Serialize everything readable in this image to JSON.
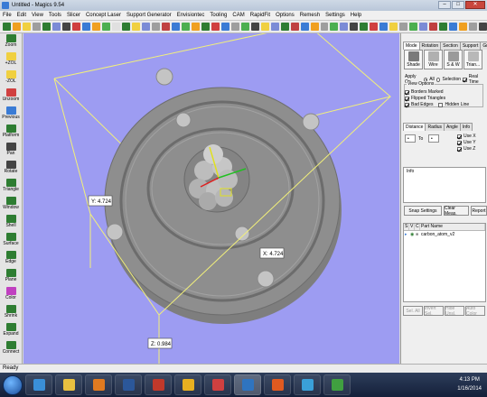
{
  "window": {
    "title": "Untitled - Magics 9.54"
  },
  "menu": [
    "File",
    "Edit",
    "View",
    "Tools",
    "Slicer",
    "Concept Laser",
    "Support Generator",
    "Envisiontec",
    "Tooling",
    "CAM",
    "RapidFit",
    "Options",
    "Remesh",
    "Settings",
    "Help"
  ],
  "toolbar_colors": [
    "#2e7d32",
    "#f0a020",
    "#f0d040",
    "#9e9e9e",
    "#2e7d32",
    "#7b8bd6",
    "#444",
    "#d04040",
    "#3a7bd5",
    "#f0a020",
    "#4caf50",
    "#e0e0e0",
    "#2e7d32",
    "#f0d040",
    "#7b8bd6",
    "#9e9e9e",
    "#c04040",
    "#3a7bd5",
    "#4caf50",
    "#f0a020",
    "#2e7d32",
    "#d04040",
    "#3a7bd5",
    "#9e9e9e",
    "#4caf50",
    "#444",
    "#f0d040",
    "#7b8bd6",
    "#2e7d32",
    "#c04040",
    "#3a7bd5",
    "#f0a020",
    "#9e9e9e",
    "#4caf50",
    "#7b8bd6",
    "#444",
    "#2e7d32",
    "#d04040",
    "#3a7bd5",
    "#f0d040",
    "#9e9e9e",
    "#4caf50",
    "#7b8bd6",
    "#c04040",
    "#2e7d32",
    "#3a7bd5",
    "#f0a020",
    "#9e9e9e",
    "#444"
  ],
  "left_tools": [
    {
      "label": "Zoom",
      "color": "#2e7d32"
    },
    {
      "label": "+ZOL",
      "color": "#f0d040"
    },
    {
      "label": "-ZOL",
      "color": "#f0d040"
    },
    {
      "label": "Unzoom",
      "color": "#d04040"
    },
    {
      "label": "Previous",
      "color": "#3a7bd5"
    },
    {
      "label": "Platform",
      "color": "#2e7d32"
    },
    {
      "label": "Pan",
      "color": "#444444"
    },
    {
      "label": "Rotate",
      "color": "#444444"
    },
    {
      "label": "Triangle",
      "color": "#2e7d32"
    },
    {
      "label": "Window",
      "color": "#2e7d32"
    },
    {
      "label": "Shell",
      "color": "#2e7d32"
    },
    {
      "label": "Surface",
      "color": "#2e7d32"
    },
    {
      "label": "Edge",
      "color": "#2e7d32"
    },
    {
      "label": "Plane",
      "color": "#2e7d32"
    },
    {
      "label": "Color",
      "color": "#c040c0"
    },
    {
      "label": "Shrink",
      "color": "#2e7d32"
    },
    {
      "label": "Expand",
      "color": "#2e7d32"
    },
    {
      "label": "Connect",
      "color": "#2e7d32"
    }
  ],
  "viewport": {
    "dim_y": "Y: 4.724",
    "dim_x": "X: 4.724",
    "dim_z": "Z: 0.984",
    "colors": {
      "background": "#9d9cf2",
      "part": "#8c8c8c",
      "bbox": "#f2f07a"
    }
  },
  "panel": {
    "tabs_top": [
      "Mode",
      "Rotation",
      "Section",
      "Support",
      "Grid"
    ],
    "modes": [
      {
        "label": "Shade",
        "color": "#7a7a7a"
      },
      {
        "label": "Wire",
        "color": "#b0b0b0"
      },
      {
        "label": "S & W",
        "color": "#9a9a9a"
      },
      {
        "label": "Trian...",
        "color": "#b8b8b8"
      }
    ],
    "apply_on": "Apply On",
    "apply_all": "All",
    "apply_selection": "Selection",
    "real_time": "Real Time",
    "view_options": "View Options",
    "borders_marked": "Borders Marked",
    "flipped_triangles": "Flipped Triangles",
    "bad_edges": "Bad Edges",
    "hidden_line": "Hidden Line",
    "tabs_mid": [
      "Distance",
      "Radius",
      "Angle",
      "Info"
    ],
    "use_x": "Use X",
    "use_y": "Use Y",
    "use_z": "Use Z",
    "to_label": "To",
    "info_label": "Info",
    "snap_settings": "Snap Settings",
    "clear_meas": "Clear Meas.",
    "report": "Report",
    "table_headers": [
      "S",
      "V",
      "C",
      "Part Name"
    ],
    "parts": [
      {
        "name": "carbon_atom_v2"
      }
    ],
    "bottom_buttons": [
      "Sel. All",
      "Invert Sel.",
      "Hide Unsl.",
      "Auto Color"
    ]
  },
  "status": "Ready",
  "taskbar": {
    "apps": [
      {
        "name": "ie",
        "color": "#3a8fd8"
      },
      {
        "name": "explorer",
        "color": "#e8c040"
      },
      {
        "name": "media",
        "color": "#e07a20"
      },
      {
        "name": "word",
        "color": "#2b579a"
      },
      {
        "name": "pdf",
        "color": "#c0392b"
      },
      {
        "name": "chrome",
        "color": "#e8b020"
      },
      {
        "name": "paint",
        "color": "#d04040"
      },
      {
        "name": "magics",
        "color": "#2f74c0"
      },
      {
        "name": "media2",
        "color": "#e05a20"
      },
      {
        "name": "app",
        "color": "#3aa0d8"
      },
      {
        "name": "app2",
        "color": "#40a040"
      }
    ],
    "time": "4:13 PM",
    "date": "1/16/2014"
  }
}
